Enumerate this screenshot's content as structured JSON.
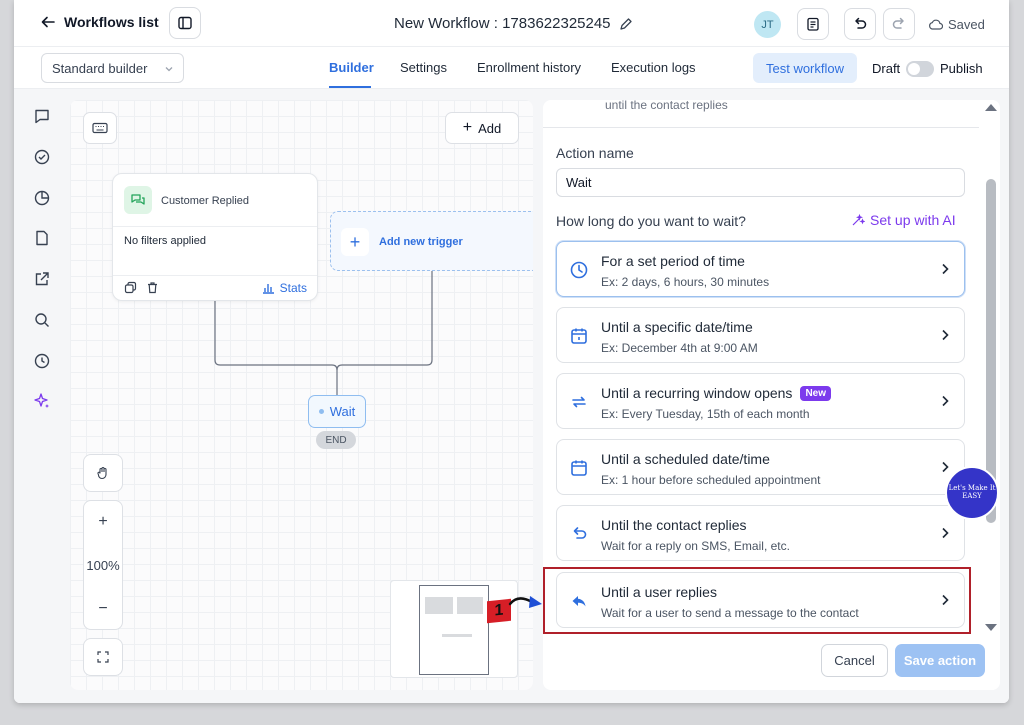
{
  "header": {
    "back_label": "Workflows list",
    "workflow_title": "New Workflow : 1783622325245",
    "avatar_initials": "JT",
    "saved_label": "Saved"
  },
  "toolbar": {
    "builder_mode": "Standard builder",
    "tabs": [
      {
        "label": "Builder",
        "active": true
      },
      {
        "label": "Settings",
        "active": false
      },
      {
        "label": "Enrollment history",
        "active": false
      },
      {
        "label": "Execution logs",
        "active": false
      }
    ],
    "test_label": "Test workflow",
    "draft_label": "Draft",
    "publish_label": "Publish",
    "publish_enabled": false
  },
  "sidebar": {
    "icons": [
      "chat-icon",
      "check-circle-icon",
      "pie-chart-icon",
      "document-icon",
      "external-link-icon",
      "search-icon",
      "history-icon",
      "sparkle-icon"
    ]
  },
  "canvas": {
    "add_label": "Add",
    "trigger": {
      "title": "Customer Replied",
      "filter_text": "No filters applied",
      "stats_label": "Stats"
    },
    "new_trigger_label": "Add new trigger",
    "wait_node_label": "Wait",
    "end_label": "END",
    "zoom_level": "100%",
    "zoom_in": "+",
    "zoom_out": "−"
  },
  "panel": {
    "top_text": "until the contact replies",
    "action_name_label": "Action name",
    "action_name_value": "Wait",
    "wait_question": "How long do you want to wait?",
    "ai_label": "Set up with AI",
    "options": [
      {
        "title": "For a set period of time",
        "subtitle": "Ex: 2 days, 6 hours, 30 minutes",
        "icon": "clock-icon",
        "selected": true
      },
      {
        "title": "Until a specific date/time",
        "subtitle": "Ex: December 4th at 9:00 AM",
        "icon": "calendar-grid-icon",
        "selected": false
      },
      {
        "title": "Until a recurring window opens",
        "subtitle": "Ex: Every Tuesday, 15th of each month",
        "icon": "repeat-icon",
        "badge": "New",
        "selected": false
      },
      {
        "title": "Until a scheduled date/time",
        "subtitle": "Ex: 1 hour before scheduled appointment",
        "icon": "calendar-icon",
        "selected": false
      },
      {
        "title": "Until the contact replies",
        "subtitle": "Wait for a reply on SMS, Email, etc.",
        "icon": "undo-arrow-icon",
        "selected": false
      },
      {
        "title": "Until a user replies",
        "subtitle": "Wait for a user to send a message to the contact",
        "icon": "reply-icon",
        "selected": false,
        "highlighted": true
      }
    ],
    "cancel_label": "Cancel",
    "save_label": "Save action"
  },
  "overlay": {
    "step_number": "1",
    "watermark_text": "Let's Make It EASY"
  },
  "colors": {
    "accent": "#2f6fde",
    "ai_purple": "#7c3aed",
    "highlight_red": "#b0202a"
  }
}
